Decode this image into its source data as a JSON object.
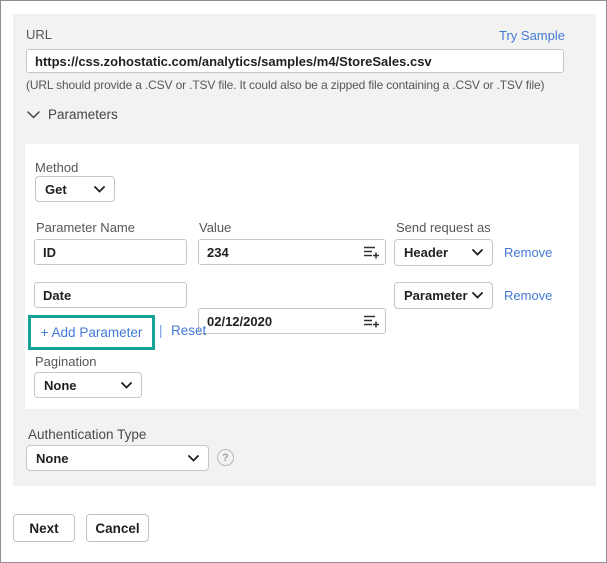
{
  "url_section": {
    "label": "URL",
    "try_sample": "Try Sample",
    "url_value": "https://css.zohostatic.com/analytics/samples/m4/StoreSales.csv",
    "helper": "(URL should provide a .CSV or .TSV file. It could also be a zipped file containing a .CSV or .TSV file)"
  },
  "parameters": {
    "header": "Parameters",
    "method_label": "Method",
    "method_value": "Get",
    "columns": {
      "name": "Parameter Name",
      "value": "Value",
      "send_as": "Send request as"
    },
    "rows": [
      {
        "name": "ID",
        "value": "234",
        "send_as": "Header",
        "remove": "Remove"
      },
      {
        "name": "Date",
        "value": "02/12/2020",
        "send_as": "Parameter",
        "remove": "Remove"
      }
    ],
    "add_parameter": "+ Add Parameter",
    "separator": "|",
    "reset": "Reset",
    "pagination_label": "Pagination",
    "pagination_value": "None"
  },
  "auth": {
    "label": "Authentication Type",
    "value": "None",
    "help": "?"
  },
  "footer": {
    "next": "Next",
    "cancel": "Cancel"
  },
  "icons": {
    "parameters_chevron": "chevron-down",
    "select_chevron": "chevron-down",
    "value_insert": "list-add-plus",
    "help": "question-mark-circle"
  },
  "colors": {
    "link_blue": "#4379d6",
    "highlight_teal": "#16a296",
    "panel_gray": "#f2f2f0"
  }
}
